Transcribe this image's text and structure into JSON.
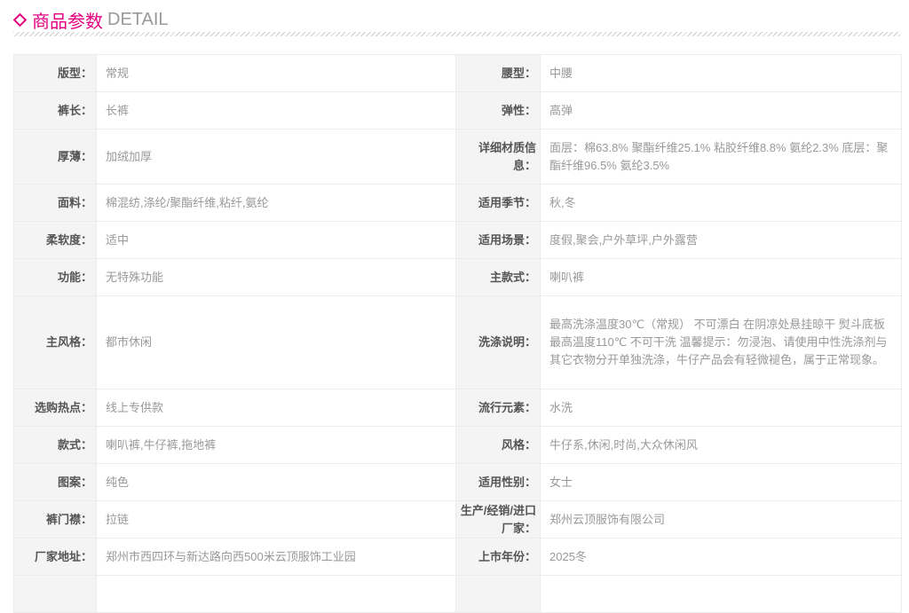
{
  "header": {
    "title_cn": "商品参数",
    "title_en": "DETAIL",
    "accent": "#e4007f"
  },
  "rows": [
    [
      {
        "label": "版型：",
        "value": "常规"
      },
      {
        "label": "腰型：",
        "value": "中腰"
      }
    ],
    [
      {
        "label": "裤长：",
        "value": "长裤"
      },
      {
        "label": "弹性：",
        "value": "高弹"
      }
    ],
    [
      {
        "label": "厚薄：",
        "value": "加绒加厚"
      },
      {
        "label": "详细材质信息：",
        "value": "面层：棉63.8% 聚酯纤维25.1% 粘胶纤维8.8% 氨纶2.3% 底层：聚酯纤维96.5% 氨纶3.5%"
      }
    ],
    [
      {
        "label": "面料：",
        "value": "棉混纺,涤纶/聚酯纤维,粘纤,氨纶"
      },
      {
        "label": "适用季节：",
        "value": "秋,冬"
      }
    ],
    [
      {
        "label": "柔软度：",
        "value": "适中"
      },
      {
        "label": "适用场景：",
        "value": "度假,聚会,户外草坪,户外露营"
      }
    ],
    [
      {
        "label": "功能：",
        "value": "无特殊功能"
      },
      {
        "label": "主款式：",
        "value": "喇叭裤"
      }
    ],
    [
      {
        "label": "主风格：",
        "value": "都市休闲"
      },
      {
        "label": "洗涤说明：",
        "value": "最高洗涤温度30℃（常规） 不可漂白 在阴凉处悬挂晾干 熨斗底板最高温度110℃ 不可干洗 温馨提示：勿浸泡、请使用中性洗涤剂与其它衣物分开单独洗涤，牛仔产品会有轻微褪色，属于正常现象。"
      }
    ],
    [
      {
        "label": "选购热点：",
        "value": "线上专供款"
      },
      {
        "label": "流行元素：",
        "value": "水洗"
      }
    ],
    [
      {
        "label": "款式：",
        "value": "喇叭裤,牛仔裤,拖地裤"
      },
      {
        "label": "风格：",
        "value": "牛仔系,休闲,时尚,大众休闲风"
      }
    ],
    [
      {
        "label": "图案：",
        "value": "纯色"
      },
      {
        "label": "适用性别：",
        "value": "女士"
      }
    ],
    [
      {
        "label": "裤门襟：",
        "value": "拉链"
      },
      {
        "label": "生产/经销/进口厂家：",
        "value": "郑州云顶服饰有限公司"
      }
    ],
    [
      {
        "label": "厂家地址：",
        "value": "郑州市西四环与新达路向西500米云顶服饰工业园"
      },
      {
        "label": "上市年份：",
        "value": "2025冬"
      }
    ]
  ]
}
